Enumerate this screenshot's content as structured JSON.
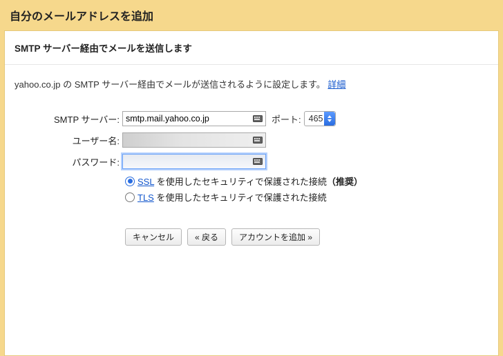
{
  "page": {
    "title": "自分のメールアドレスを追加"
  },
  "panel": {
    "title": "SMTP サーバー経由でメールを送信します",
    "intro_text": "yahoo.co.jp の SMTP サーバー経由でメールが送信されるように設定します。",
    "intro_link": "詳細"
  },
  "form": {
    "smtp": {
      "label": "SMTP サーバー:",
      "value": "smtp.mail.yahoo.co.jp"
    },
    "port": {
      "label": "ポート:",
      "value": "465"
    },
    "username": {
      "label": "ユーザー名:",
      "value": ""
    },
    "password": {
      "label": "パスワード:",
      "value": ""
    },
    "security": {
      "ssl": {
        "link": "SSL",
        "text": " を使用したセキュリティで保護された接続",
        "suffix": "（推奨）",
        "checked": true
      },
      "tls": {
        "link": "TLS",
        "text": " を使用したセキュリティで保護された接続",
        "checked": false
      }
    }
  },
  "buttons": {
    "cancel": "キャンセル",
    "back": "« 戻る",
    "add": "アカウントを追加 »"
  }
}
